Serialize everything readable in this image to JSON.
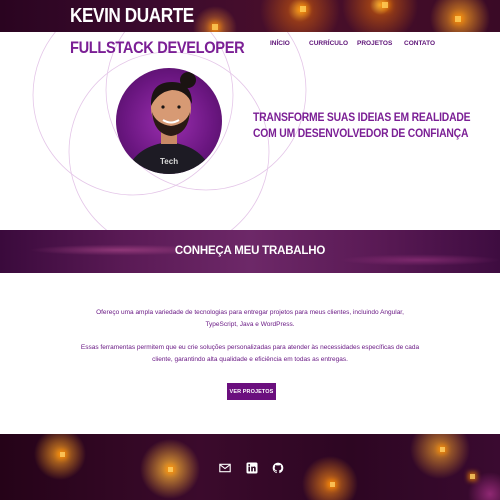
{
  "header": {
    "brand_name": "KEVIN DUARTE"
  },
  "hero": {
    "role_title": "FULLSTACK DEVELOPER",
    "nav": [
      {
        "label": "INÍCIO"
      },
      {
        "label": "CURRÍCULO"
      },
      {
        "label": "PROJETOS"
      },
      {
        "label": "CONTATO"
      }
    ],
    "tagline_line1": "TRANSFORME SUAS IDEIAS EM REALIDADE",
    "tagline_line2": "COM UM DESENVOLVEDOR DE CONFIANÇA",
    "avatar_shirt_text": "Tech"
  },
  "work": {
    "heading": "CONHEÇA MEU TRABALHO",
    "paragraph1": "Ofereço uma ampla variedade de tecnologias para entregar projetos para meus clientes, incluindo Angular, TypeScript, Java e WordPress.",
    "paragraph2": "Essas ferramentas permitem que eu crie soluções personalizadas para atender às necessidades específicas de cada cliente, garantindo alta qualidade e eficiência em todas as entregas.",
    "cta_label": "VER PROJETOS"
  },
  "footer": {
    "social_icons": [
      "email-icon",
      "linkedin-icon",
      "github-icon"
    ]
  },
  "colors": {
    "accent_purple": "#7b1f95",
    "button_purple": "#6b0f7e",
    "glow_orange": "#ffa028"
  }
}
